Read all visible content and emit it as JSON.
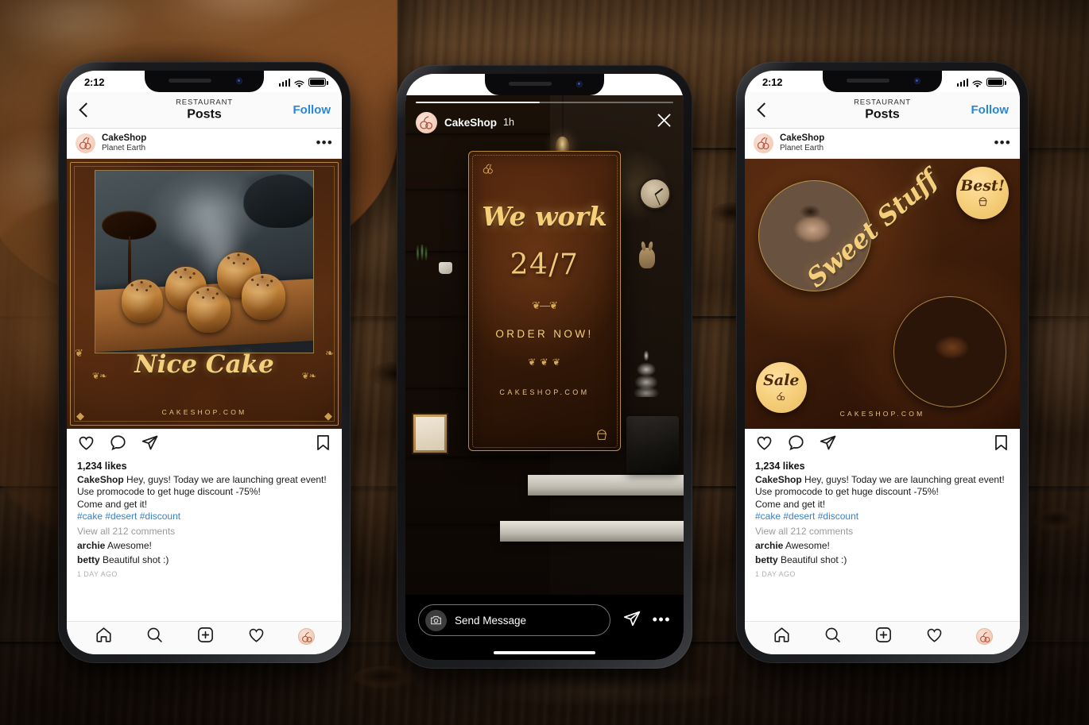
{
  "scene": {
    "background": "wooden-table-with-tan-fabric",
    "description": "Three iPhone mockups on rustic wood with brown suede cloth",
    "colors": {
      "wood": "#442c18",
      "fabric": "#a96b36",
      "gold": "#f4cf7c",
      "ig_blue": "#2b87d4"
    }
  },
  "status_bar": {
    "time": "2:12",
    "signal": "signal-bars",
    "wifi": "wifi",
    "battery": "battery-full"
  },
  "ig_header": {
    "back": "chevron-left",
    "kicker": "RESTAURANT",
    "title": "Posts",
    "follow_label": "Follow"
  },
  "post_header": {
    "username": "CakeShop",
    "location": "Planet Earth",
    "more": "•••"
  },
  "post_left_art": {
    "script_text": "Nice Cake",
    "url": "CAKESHOP.COM",
    "photo": "profiteroles-with-chocolate-sauce"
  },
  "post_right_art": {
    "script_text": "Sweet Stuff",
    "url": "CAKESHOP.COM",
    "badge_best": "Best!",
    "badge_sale": "Sale",
    "photo_top": "chocolate-cupcake",
    "photo_bottom": "chocolate-glazed-muffin"
  },
  "post_actions": {
    "like": "heart-icon",
    "comment": "comment-icon",
    "share": "share-icon",
    "save": "bookmark-icon"
  },
  "caption": {
    "likes": "1,234 likes",
    "username": "CakeShop",
    "line1": " Hey, guys! Today we are launching great event!",
    "line2": "Use promocode to get huge discount -75%!",
    "line3": "Come and get it!",
    "hashtags": "#cake #desert #discount",
    "view_comments": "View all 212 comments",
    "comments": [
      {
        "user": "archie",
        "text": " Awesome!"
      },
      {
        "user": "betty",
        "text": " Beautiful shot :)"
      }
    ],
    "timestamp": "1 DAY AGO"
  },
  "tabbar": {
    "home": "home-icon",
    "search": "search-icon",
    "add": "plus-square-icon",
    "activity": "heart-icon",
    "profile": "profile-avatar"
  },
  "story": {
    "progress_percent": 48,
    "username": "CakeShop",
    "time_ago": "1h",
    "close": "close-icon",
    "card": {
      "title": "We work",
      "big": "24/7",
      "divider": "❦—❦",
      "cta": "ORDER NOW!",
      "ornament": "❦ ❦ ❦",
      "url": "CAKESHOP.COM",
      "logo": "cherry-logo",
      "cupcake": "cupcake-icon"
    },
    "message_placeholder": "Send Message",
    "camera": "camera-icon",
    "send": "share-icon",
    "more": "•••"
  }
}
